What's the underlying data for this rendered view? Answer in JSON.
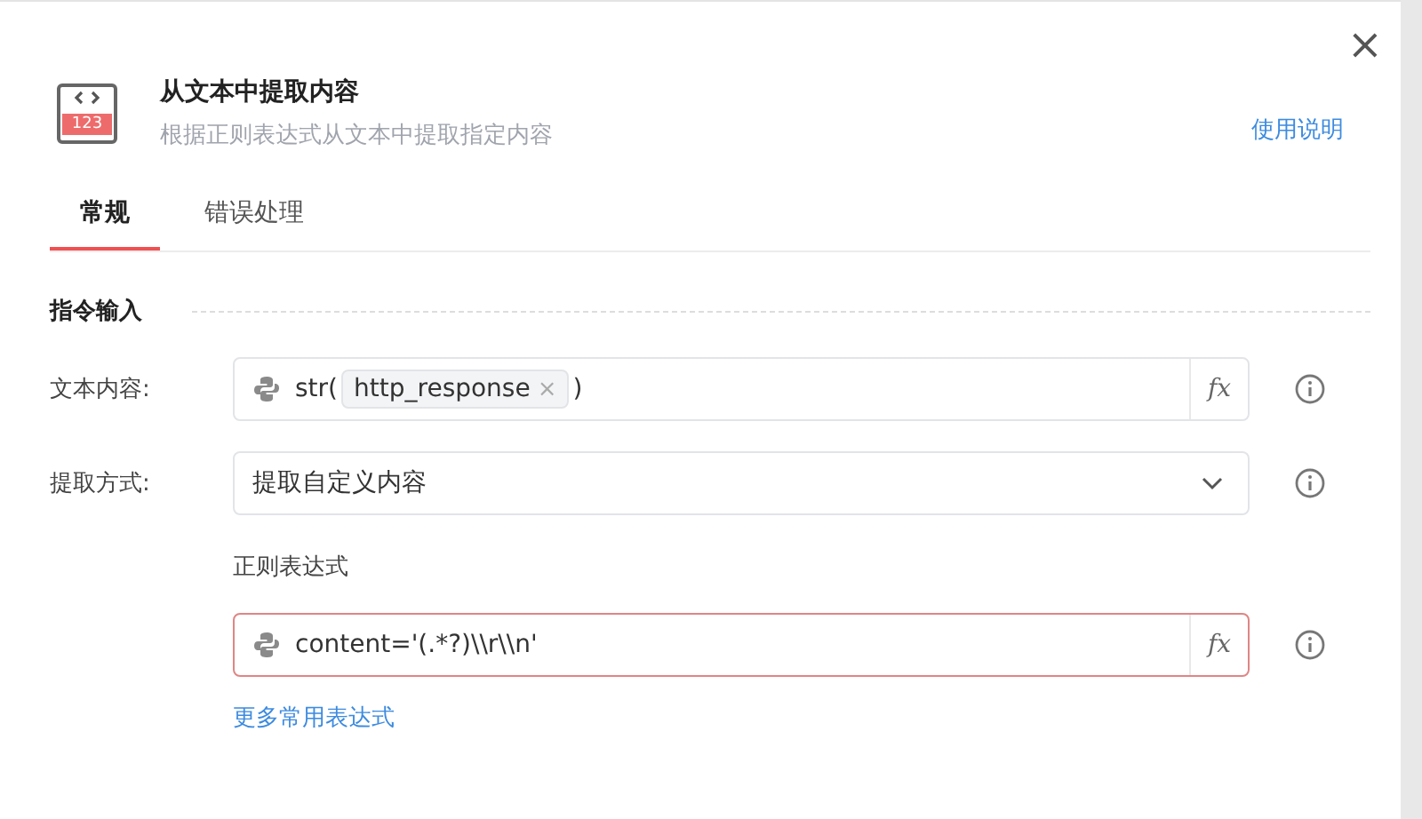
{
  "header": {
    "icon_number": "123",
    "title": "从文本中提取内容",
    "subtitle": "根据正则表达式从文本中提取指定内容",
    "help_link": "使用说明",
    "close": "×"
  },
  "tabs": [
    {
      "label": "常规",
      "selected": true
    },
    {
      "label": "错误处理",
      "selected": false
    }
  ],
  "section": {
    "title": "指令输入"
  },
  "fields": [
    {
      "kind": "expression",
      "label": "文本内容:",
      "prefix": "str(",
      "token": "http_response",
      "token_remove": "×",
      "suffix": ")",
      "fx": "fx",
      "invalid": false
    },
    {
      "kind": "select",
      "label": "提取方式:",
      "value": "提取自定义内容"
    },
    {
      "kind": "caption",
      "label": "正则表达式"
    },
    {
      "kind": "code",
      "value": "content='(.*?)\\\\r\\\\n'",
      "fx": "fx",
      "invalid": true
    },
    {
      "kind": "link",
      "value": "更多常用表达式"
    }
  ]
}
